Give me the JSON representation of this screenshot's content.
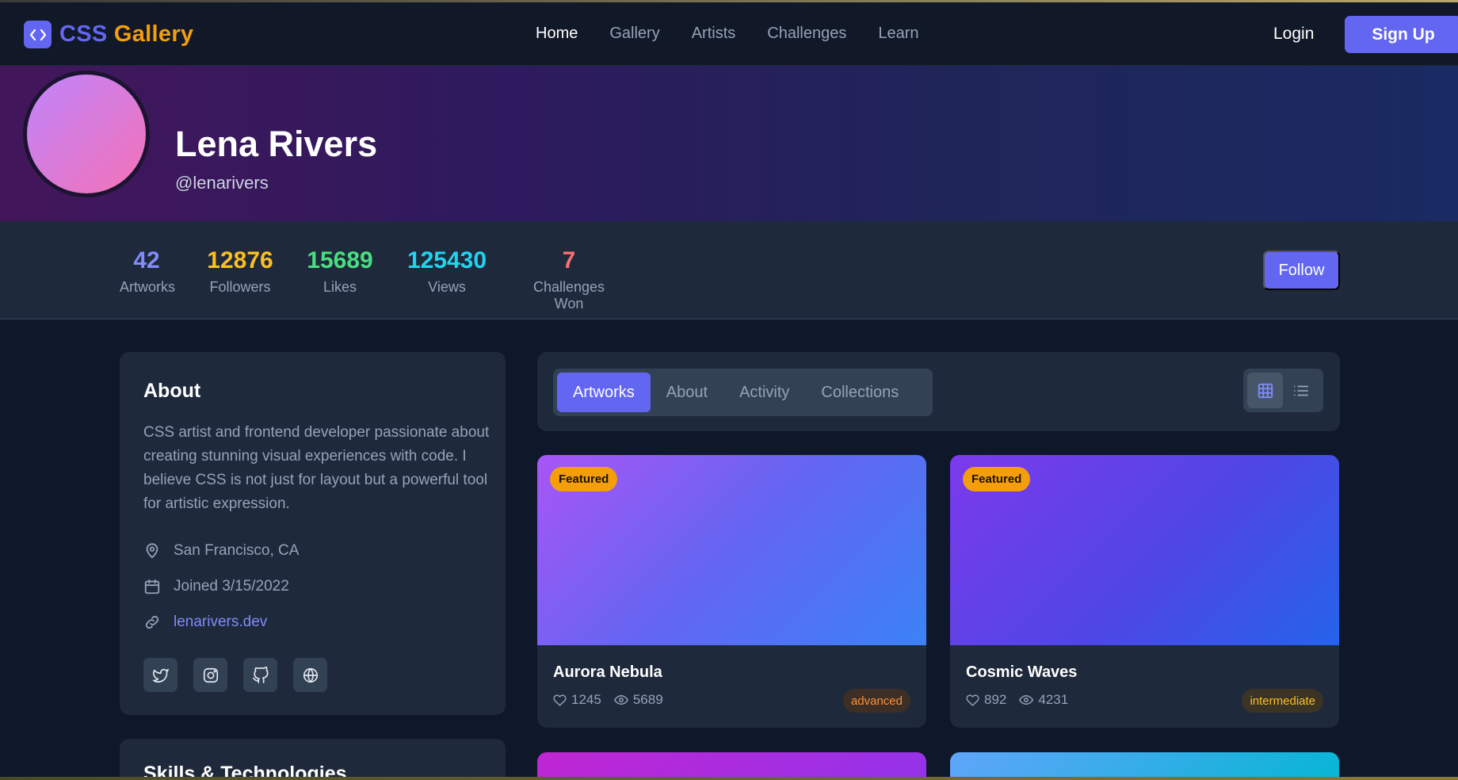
{
  "nav": {
    "logo_css": "CSS",
    "logo_gallery": "Gallery",
    "links": [
      "Home",
      "Gallery",
      "Artists",
      "Challenges",
      "Learn"
    ],
    "login": "Login",
    "signup": "Sign Up"
  },
  "profile": {
    "name": "Lena Rivers",
    "handle": "@lenarivers"
  },
  "stats": [
    {
      "value": "42",
      "label": "Artworks",
      "color": "#818cf8"
    },
    {
      "value": "12876",
      "label": "Followers",
      "color": "#fbbf24"
    },
    {
      "value": "15689",
      "label": "Likes",
      "color": "#4ade80"
    },
    {
      "value": "125430",
      "label": "Views",
      "color": "#22d3ee"
    },
    {
      "value": "7",
      "label": "Challenges Won",
      "color": "#f87171"
    }
  ],
  "follow_label": "Follow",
  "about": {
    "title": "About",
    "bio": "CSS artist and frontend developer passionate about creating stunning visual experiences with code. I believe CSS is not just for layout but a powerful tool for artistic expression.",
    "location": "San Francisco, CA",
    "joined": "Joined 3/15/2022",
    "website": "lenarivers.dev",
    "socials": [
      "twitter-icon",
      "instagram-icon",
      "github-icon",
      "globe-icon"
    ]
  },
  "skills": {
    "title": "Skills & Technologies"
  },
  "tabs": [
    "Artworks",
    "About",
    "Activity",
    "Collections"
  ],
  "artworks": [
    {
      "title": "Aurora Nebula",
      "badge": "Featured",
      "likes": "1245",
      "views": "5689",
      "level": "advanced"
    },
    {
      "title": "Cosmic Waves",
      "badge": "Featured",
      "likes": "892",
      "views": "4231",
      "level": "intermediate"
    }
  ]
}
